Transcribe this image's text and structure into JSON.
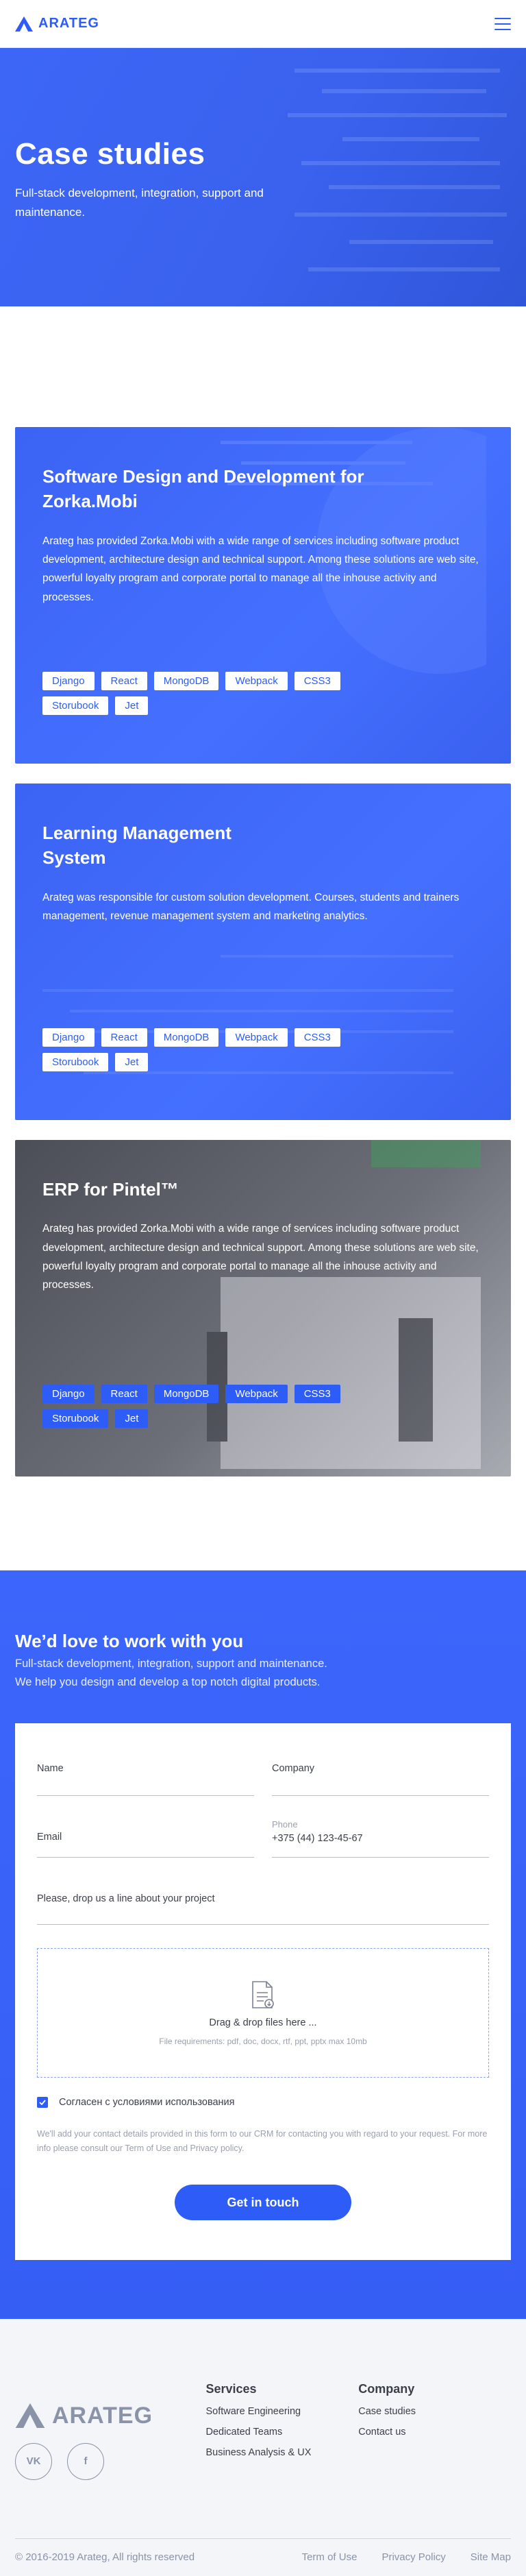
{
  "header": {
    "logo_text": "ARATEG",
    "menu_icon": "hamburger-menu-icon"
  },
  "hero": {
    "title": "Case studies",
    "subtitle": "Full-stack development, integration, support and maintenance."
  },
  "cases": [
    {
      "title": "Software Design and Development for Zorka.Mobi",
      "description": "Arateg has provided Zorka.Mobi with a wide range of services including software product development, architecture design and technical support. Among these solutions are web site, powerful loyalty program and corporate portal to manage all the inhouse activity and processes.",
      "tags": [
        "Django",
        "React",
        "MongoDB",
        "Webpack",
        "CSS3",
        "Storubook",
        "Jet"
      ]
    },
    {
      "title": "Learning Management System",
      "description": "Arateg was responsible for custom solution development. Courses, students and trainers management, revenue management system and marketing analytics.",
      "tags": [
        "Django",
        "React",
        "MongoDB",
        "Webpack",
        "CSS3",
        "Storubook",
        "Jet"
      ]
    },
    {
      "title": "ERP for Pintel™",
      "description": "Arateg has provided Zorka.Mobi with a wide range of services including software product development, architecture design and technical support. Among these solutions are web site, powerful loyalty program and corporate portal to manage all the inhouse activity and processes.",
      "tags": [
        "Django",
        "React",
        "MongoDB",
        "Webpack",
        "CSS3",
        "Storubook",
        "Jet"
      ]
    }
  ],
  "contact": {
    "title": "We’d love to work with you",
    "subtitle_line1": "Full-stack development, integration, support and maintenance.",
    "subtitle_line2": "We help you design and develop a top notch digital products.",
    "form": {
      "name_label": "Name",
      "company_label": "Company",
      "email_label": "Email",
      "phone_label": "Phone",
      "phone_value": "+375 (44) 123-45-67",
      "message_label": "Please, drop us a line about your project",
      "drop_title": "Drag & drop files here ...",
      "drop_requirements": "File requirements: pdf, doc, docx, rtf, ppt, pptx max 10mb",
      "agree_label": "Согласен с условиями использования",
      "notice": "We'll add your contact details provided in this form to our CRM for contacting you with regard to your request. For more info please consult our Term of Use and Privacy policy.",
      "submit_label": "Get in touch"
    }
  },
  "footer": {
    "logo_text": "ARATEG",
    "social": [
      "VK",
      "f"
    ],
    "services_title": "Services",
    "services": [
      "Software Engineering",
      "Dedicated Teams",
      "Business Analysis & UX"
    ],
    "company_title": "Company",
    "company": [
      "Case studies",
      "Contact us"
    ],
    "copyright": "© 2016-2019 Arateg, All rights reserved",
    "terms": "Term of Use",
    "privacy": "Privacy Policy",
    "sitemap": "Site Map"
  },
  "colors": {
    "brand": "#2d5cf6",
    "footer_bg": "#f3f5f9"
  }
}
